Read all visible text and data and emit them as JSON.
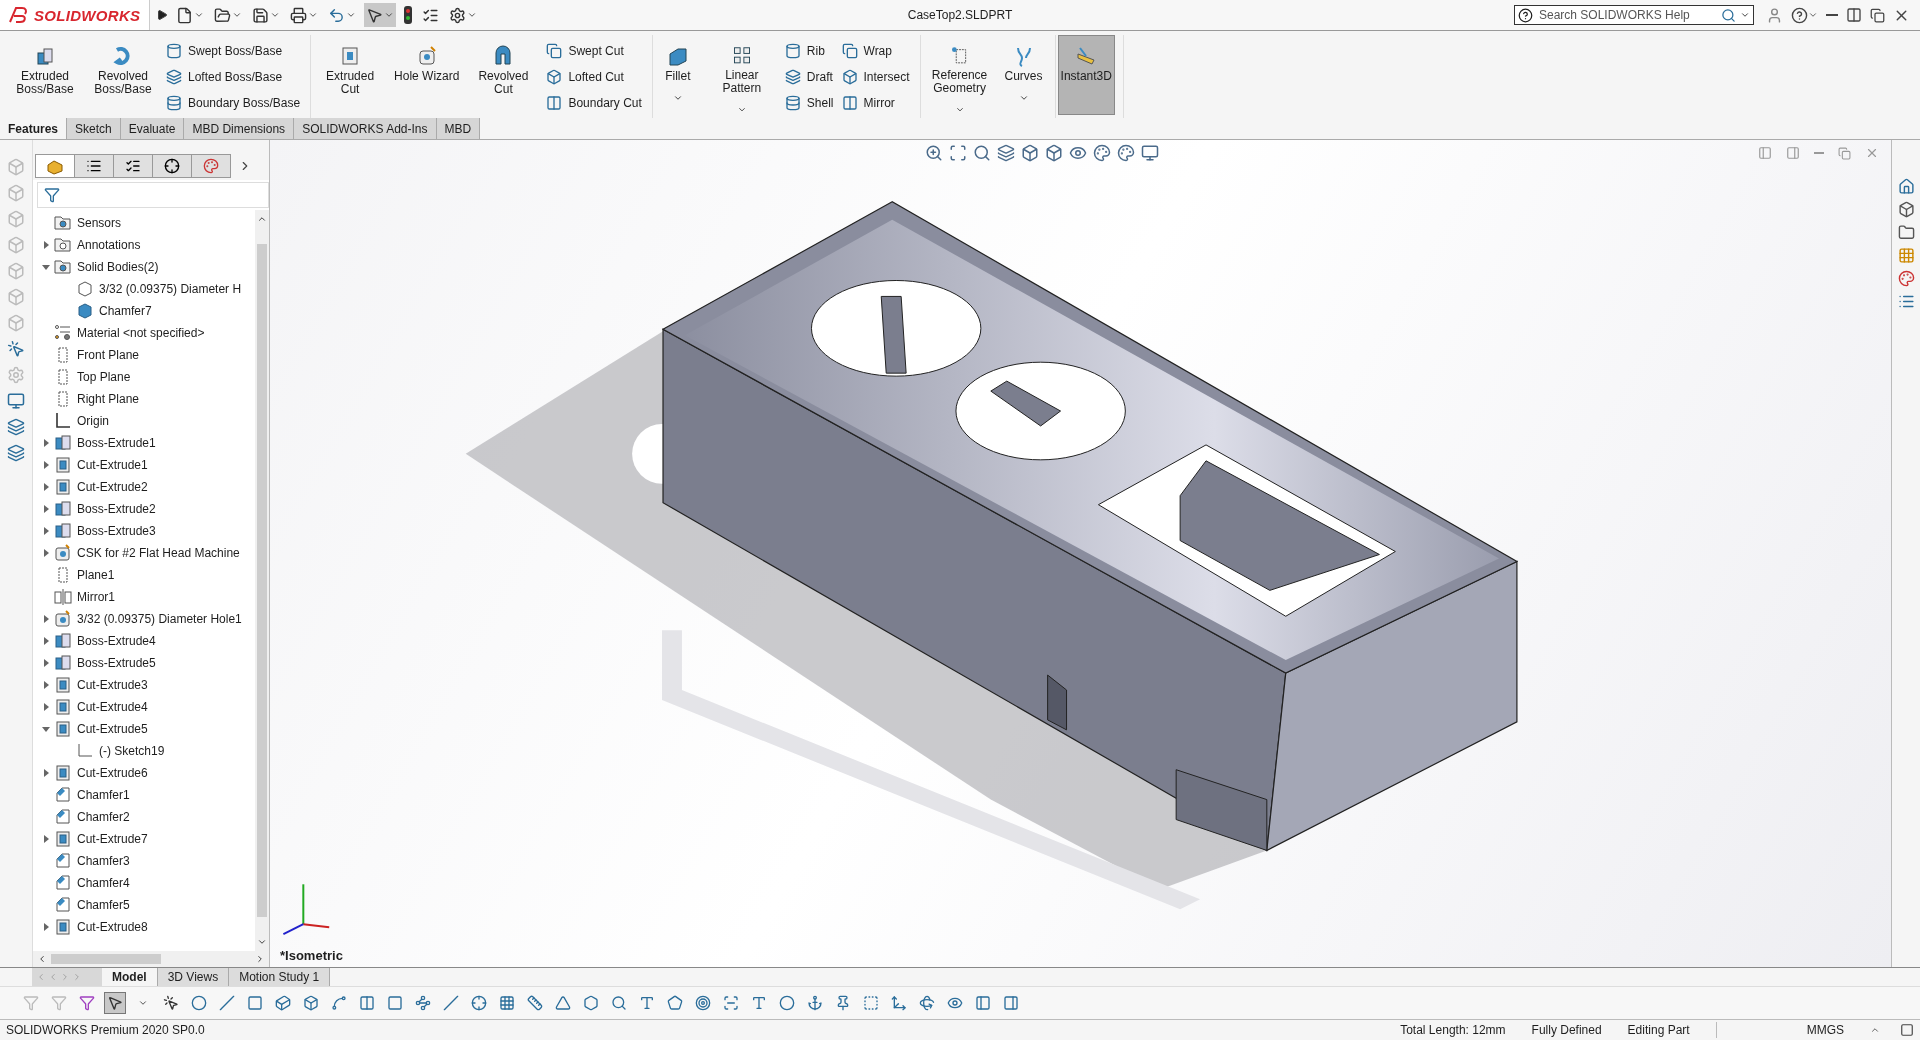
{
  "title_bar": {
    "logo": "SOLIDWORKS",
    "document_title": "CaseTop2.SLDPRT",
    "search": {
      "placeholder": "Search SOLIDWORKS Help"
    }
  },
  "ribbon": [
    {
      "items": [
        {
          "kind": "large",
          "label": "Extruded Boss/Base",
          "dropdown": false,
          "selected": false
        },
        {
          "kind": "large",
          "label": "Revolved Boss/Base",
          "dropdown": false,
          "selected": false
        },
        {
          "kind": "stack",
          "labels": [
            "Swept Boss/Base",
            "Lofted Boss/Base",
            "Boundary Boss/Base"
          ]
        }
      ]
    },
    {
      "items": [
        {
          "kind": "large",
          "label": "Extruded Cut",
          "dropdown": false,
          "selected": false
        },
        {
          "kind": "large",
          "label": "Hole Wizard",
          "dropdown": false,
          "selected": false
        },
        {
          "kind": "large",
          "label": "Revolved Cut",
          "dropdown": false,
          "selected": false
        },
        {
          "kind": "stack",
          "labels": [
            "Swept Cut",
            "Lofted Cut",
            "Boundary Cut"
          ]
        }
      ]
    },
    {
      "items": [
        {
          "kind": "large",
          "label": "Fillet",
          "dropdown": true,
          "selected": false
        },
        {
          "kind": "large",
          "label": "Linear Pattern",
          "dropdown": true,
          "selected": false
        },
        {
          "kind": "stack",
          "labels": [
            "Rib",
            "Draft",
            "Shell"
          ]
        },
        {
          "kind": "stack",
          "labels": [
            "Wrap",
            "Intersect",
            "Mirror"
          ]
        }
      ]
    },
    {
      "items": [
        {
          "kind": "large",
          "label": "Reference Geometry",
          "dropdown": true,
          "selected": false
        },
        {
          "kind": "large",
          "label": "Curves",
          "dropdown": true,
          "selected": false
        }
      ]
    },
    {
      "items": [
        {
          "kind": "large",
          "label": "Instant3D",
          "dropdown": false,
          "selected": true
        }
      ]
    }
  ],
  "tabs": [
    {
      "label": "Features",
      "selected": true
    },
    {
      "label": "Sketch",
      "selected": false
    },
    {
      "label": "Evaluate",
      "selected": false
    },
    {
      "label": "MBD Dimensions",
      "selected": false
    },
    {
      "label": "SOLIDWORKS Add-Ins",
      "selected": false
    },
    {
      "label": "MBD",
      "selected": false
    }
  ],
  "feature_tree": [
    {
      "label": "Sensors",
      "kind": "sensors"
    },
    {
      "label": "Annotations",
      "kind": "annotations",
      "expanded": false
    },
    {
      "label": "Solid Bodies(2)",
      "kind": "bodies",
      "expanded": true,
      "children": [
        {
          "label": "3/32 (0.09375) Diameter H",
          "kind": "body-outline"
        },
        {
          "label": "Chamfer7",
          "kind": "body"
        }
      ]
    },
    {
      "label": "Material <not specified>",
      "kind": "material"
    },
    {
      "label": "Front Plane",
      "kind": "plane"
    },
    {
      "label": "Top Plane",
      "kind": "plane"
    },
    {
      "label": "Right Plane",
      "kind": "plane"
    },
    {
      "label": "Origin",
      "kind": "origin"
    },
    {
      "label": "Boss-Extrude1",
      "kind": "boss",
      "expanded": false
    },
    {
      "label": "Cut-Extrude1",
      "kind": "cut",
      "expanded": false
    },
    {
      "label": "Cut-Extrude2",
      "kind": "cut",
      "expanded": false
    },
    {
      "label": "Boss-Extrude2",
      "kind": "boss",
      "expanded": false
    },
    {
      "label": "Boss-Extrude3",
      "kind": "boss",
      "expanded": false
    },
    {
      "label": "CSK for #2 Flat Head Machine",
      "kind": "hole",
      "expanded": false
    },
    {
      "label": "Plane1",
      "kind": "plane"
    },
    {
      "label": "Mirror1",
      "kind": "mirror"
    },
    {
      "label": "3/32 (0.09375) Diameter Hole1",
      "kind": "hole",
      "expanded": false
    },
    {
      "label": "Boss-Extrude4",
      "kind": "boss",
      "expanded": false
    },
    {
      "label": "Boss-Extrude5",
      "kind": "boss",
      "expanded": false
    },
    {
      "label": "Cut-Extrude3",
      "kind": "cut",
      "expanded": false
    },
    {
      "label": "Cut-Extrude4",
      "kind": "cut",
      "expanded": false
    },
    {
      "label": "Cut-Extrude5",
      "kind": "cut",
      "expanded": true,
      "children": [
        {
          "label": "(-) Sketch19",
          "kind": "sketch"
        }
      ]
    },
    {
      "label": "Cut-Extrude6",
      "kind": "cut",
      "expanded": false
    },
    {
      "label": "Chamfer1",
      "kind": "chamfer"
    },
    {
      "label": "Chamfer2",
      "kind": "chamfer"
    },
    {
      "label": "Cut-Extrude7",
      "kind": "cut",
      "expanded": false
    },
    {
      "label": "Chamfer3",
      "kind": "chamfer"
    },
    {
      "label": "Chamfer4",
      "kind": "chamfer"
    },
    {
      "label": "Chamfer5",
      "kind": "chamfer"
    },
    {
      "label": "Cut-Extrude8",
      "kind": "cut",
      "expanded": false
    }
  ],
  "viewport": {
    "view_label": "*Isometric"
  },
  "bottom_tabs": [
    {
      "label": "Model",
      "selected": true
    },
    {
      "label": "3D Views",
      "selected": false
    },
    {
      "label": "Motion Study 1",
      "selected": false
    }
  ],
  "status_bar": {
    "product": "SOLIDWORKS Premium 2020 SP0.0",
    "fields": [
      "Total Length: 12mm",
      "Fully Defined",
      "Editing Part"
    ],
    "units": "MMGS"
  }
}
